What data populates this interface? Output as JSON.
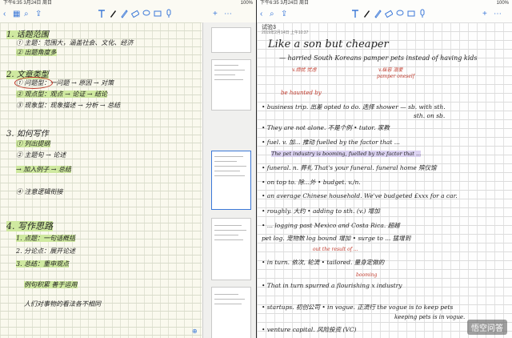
{
  "left": {
    "status": {
      "time": "下午6:35",
      "date": "3月24日 周日",
      "battery": "100%"
    },
    "toolbar": {
      "back": "‹",
      "grid": "▦",
      "search": "⌕",
      "share": "⇪",
      "add": "+",
      "more": "⋯"
    },
    "notes": {
      "s1": "1. 话题范围",
      "s1a": "① 主题：范围大，涵盖社会、文化、经济",
      "s1b": "② 出题角度多",
      "s2": "2. 文章类型",
      "s2a": "① 问题型：一问题 → 原因 → 对策",
      "s2b": "② 观点型：观点 → 论证 → 结论",
      "s2c": "③ 现象型：现象描述 → 分析 → 总结",
      "s3": "3. 如何写作",
      "s3a": "① 列出提纲",
      "s3b": "② 主题句 → 论述",
      "s3c": "→ 加入例子 → 总结",
      "s3d": "④ 注意逻辑衔接",
      "s4": "4. 写作思路",
      "s4a": "1. 点题：一句话概括",
      "s4b": "2. 分论点：展开论述",
      "s4c": "3. 总结：重申观点",
      "s4d": "例句积累  善于运用",
      "s4e": "人们对事物的看法各不相同"
    },
    "thumbs": [
      "page-1",
      "page-2",
      "page-3",
      "page-4",
      "page-5"
    ]
  },
  "right": {
    "status": {
      "time": "下午6:35",
      "date": "3月24日 周日",
      "battery": "100%"
    },
    "title": "试验3",
    "subtitle": "2019年2月14日 上午10:37",
    "toolbar": {
      "back": "‹",
      "search": "⌕",
      "share": "⇪",
      "add": "+",
      "more": "⋯"
    },
    "notes": {
      "h1": "Like a son but cheaper",
      "h2": "— harried South Koreans pamper pets instead of having kids",
      "r1": "v.烦扰 忧虑",
      "r2": "v.纵容 溺爱",
      "r3": "pamper oneself",
      "r4": "be haunted by",
      "l1": "• business trip. 出差   opted to do. 选择   shower — sb. with sth.",
      "l1b": "sth. on sb.",
      "l2": "• They are not alone. 不是个例   • tutor. 家教",
      "l3": "• fuel. v. 加... 推动  fuelled by the factor that ...",
      "l3b": "The pet industry is booming, fuelled by the factor that ...",
      "l4": "• funeral. n. 葬礼   That's your funeral.  funeral home 殡仪馆",
      "l5": "• on top to. 除...外     • budget. v./n.",
      "l6": "• an average Chinese household.   We've budgeted £xxx for a car.",
      "l7": "• roughly. 大约   • adding to sth. (v.) 增加",
      "l8": "• ... logging past Mexico and Costa Rica. 超越",
      "l9": "pet log. 宠物数   log bound 增加   • surge to ... 猛增到",
      "l10": "out the result of ...",
      "l11": "• in turn. 依次, 轮流   • tailored. 量身定做的",
      "l12": "booming",
      "l13": "• That in turn spurred a flourishing x industry",
      "l14": "• startups. 初创公司   • in vogue. 正流行   the vogue is to keep pets",
      "l15": "keeping pets is in vogue.",
      "l16": "• venture capital. 风险投资 (VC)"
    },
    "watermark": "悟空问答"
  }
}
